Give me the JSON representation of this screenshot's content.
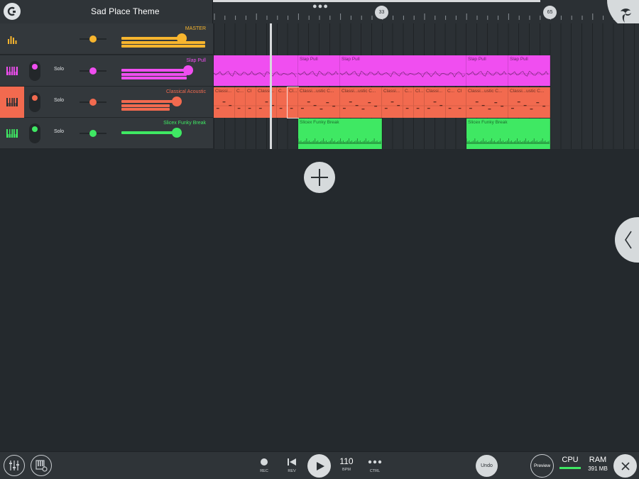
{
  "project": {
    "title": "Sad Place Theme"
  },
  "ruler": {
    "markers": [
      {
        "label": "33"
      },
      {
        "label": "65"
      }
    ]
  },
  "colors": {
    "master": "#f7b52e",
    "slap_pull": "#f04ef0",
    "classical_acoustic": "#f26a4f",
    "slicex": "#3fe863"
  },
  "tracks": [
    {
      "name": "MASTER",
      "color": "#f7b52e",
      "icon": "mixer-levels-icon",
      "solo_label": "",
      "mute_led": "",
      "volume": 0.82,
      "selected": false
    },
    {
      "name": "Slap Pull",
      "color": "#f04ef0",
      "icon": "piano-keys-icon",
      "solo_label": "Solo",
      "mute_led": "#f04ef0",
      "volume": 0.9,
      "selected": false
    },
    {
      "name": "Classical Acoustic",
      "color": "#f26a4f",
      "icon": "piano-keys-icon",
      "solo_label": "Solo",
      "mute_led": "#f26a4f",
      "volume": 0.75,
      "selected": true
    },
    {
      "name": "Slicex Funky Break",
      "color": "#3fe863",
      "icon": "piano-keys-icon",
      "solo_label": "Solo",
      "mute_led": "#3fe863",
      "volume": 0.75,
      "selected": false
    }
  ],
  "clips": {
    "slap_pull": [
      {
        "label": ""
      },
      {
        "label": "Slap Pull"
      },
      {
        "label": "Slap Pull"
      },
      {
        "label": "Slap Pull"
      },
      {
        "label": "Slap Pull"
      }
    ],
    "classical_acoustic": [
      {
        "label": "Classi..."
      },
      {
        "label": "C..."
      },
      {
        "label": "Cl"
      },
      {
        "label": "Classi..."
      },
      {
        "label": "C..."
      },
      {
        "label": "Cl..."
      },
      {
        "label": "Classi...ustic C..."
      },
      {
        "label": "Classi...ustic C..."
      },
      {
        "label": "Classi..."
      },
      {
        "label": "C..."
      },
      {
        "label": "Cl..."
      },
      {
        "label": "Classi..."
      },
      {
        "label": "C..."
      },
      {
        "label": "Cl"
      },
      {
        "label": "Classi...ustic C..."
      },
      {
        "label": "Classi...ustic C..."
      }
    ],
    "slicex": [
      {
        "label": "Slicex Funky Break"
      },
      {
        "label": "Slicex Funky Break"
      }
    ]
  },
  "transport": {
    "rec_label": "REC",
    "rev_label": "REV",
    "tempo": "110",
    "tempo_label": "BPM",
    "ctrl_label": "CTRL"
  },
  "toolbar": {
    "undo_label": "Undo",
    "preview_label": "Preview",
    "cpu_label": "CPU",
    "ram_label": "RAM",
    "ram_value": "391 MB"
  }
}
